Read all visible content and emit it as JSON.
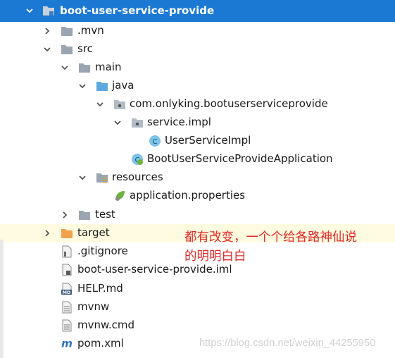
{
  "tree": {
    "items": [
      {
        "label": "boot-user-service-provide",
        "icon": "module-folder-icon"
      },
      {
        "label": ".mvn",
        "icon": "folder-icon"
      },
      {
        "label": "src",
        "icon": "folder-icon"
      },
      {
        "label": "main",
        "icon": "folder-icon"
      },
      {
        "label": "java",
        "icon": "source-folder-icon"
      },
      {
        "label": "com.onlyking.bootuserserviceprovide",
        "icon": "package-icon"
      },
      {
        "label": "service.impl",
        "icon": "package-icon"
      },
      {
        "label": "UserServiceImpl",
        "icon": "class-icon"
      },
      {
        "label": "BootUserServiceProvideApplication",
        "icon": "spring-boot-class-icon"
      },
      {
        "label": "resources",
        "icon": "resources-folder-icon"
      },
      {
        "label": "application.properties",
        "icon": "spring-properties-icon"
      },
      {
        "label": "test",
        "icon": "folder-icon"
      },
      {
        "label": "target",
        "icon": "excluded-folder-icon"
      },
      {
        "label": ".gitignore",
        "icon": "file-icon"
      },
      {
        "label": "boot-user-service-provide.iml",
        "icon": "iml-file-icon"
      },
      {
        "label": "HELP.md",
        "icon": "markdown-file-icon"
      },
      {
        "label": "mvnw",
        "icon": "text-file-icon"
      },
      {
        "label": "mvnw.cmd",
        "icon": "text-file-icon"
      },
      {
        "label": "pom.xml",
        "icon": "maven-icon"
      }
    ],
    "class_badge": "C",
    "markdown_badge": "MD",
    "maven_badge": "m"
  },
  "annotation": {
    "line1": "都有改变，一个个给各路神仙说",
    "line2": "的明明白白"
  },
  "watermark": "https://blog.csdn.net/weixin_44255950",
  "colors": {
    "selection": "#1b79d4",
    "highlight": "#fffbe0",
    "annotation": "#e22828",
    "folder": "#9aa5b1",
    "source": "#5ea8e0",
    "target": "#f0a14a"
  }
}
